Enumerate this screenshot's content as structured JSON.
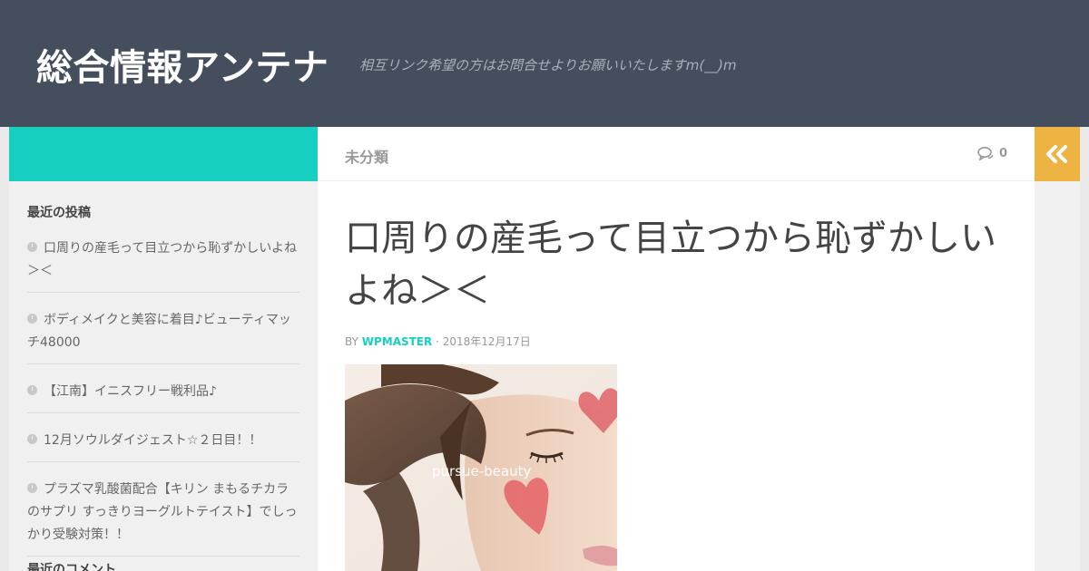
{
  "header": {
    "site_title": "総合情報アンテナ",
    "site_description": "相互リンク希望の方はお問合せよりお願いいたしますm(__)m"
  },
  "sidebar": {
    "recent_posts_title": "最近の投稿",
    "recent_posts": [
      {
        "label": "口周りの産毛って目立つから恥ずかしいよね＞＜"
      },
      {
        "label": "ボディメイクと美容に着目♪ビューティマッチ48000"
      },
      {
        "label": "【江南】イニスフリー戦利品♪"
      },
      {
        "label": "12月ソウルダイジェスト☆２日目！！"
      },
      {
        "label": "プラズマ乳酸菌配合【キリン まもるチカラのサプリ すっきりヨーグルトテイスト】でしっかり受験対策！！"
      }
    ],
    "recent_comments_title": "最近のコメント"
  },
  "post": {
    "category": "未分類",
    "comment_count": "0",
    "title": "口周りの産毛って目立つから恥ずかしいよね＞＜",
    "byline_prefix": "BY",
    "author": "WPMASTER",
    "date": "· 2018年12月17日",
    "image_watermark": "pursue-beauty"
  },
  "icons": {
    "comment": "comment-icon",
    "clock": "clock-icon",
    "sidebar_toggle": "double-chevron-left-icon"
  },
  "colors": {
    "header_bg": "#454e5c",
    "accent_teal": "#16cfc1",
    "toggle_orange": "#edb443"
  }
}
